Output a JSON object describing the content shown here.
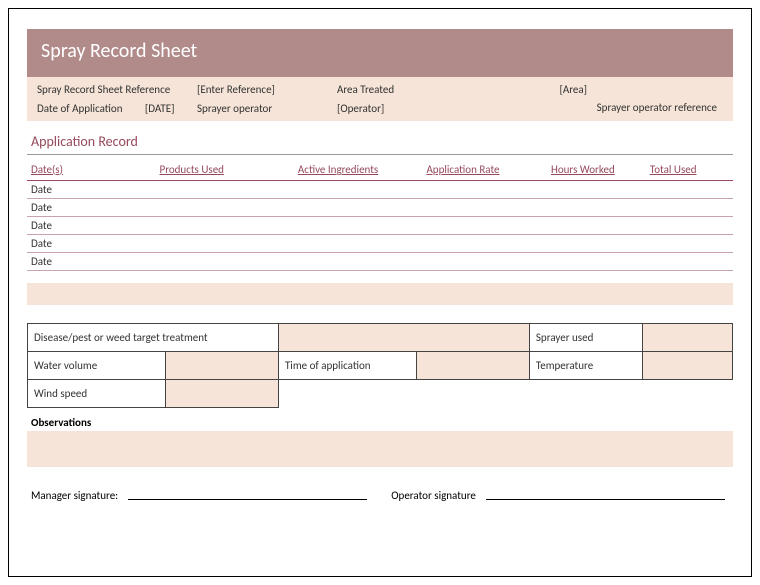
{
  "title": "Spray Record Sheet",
  "meta": {
    "ref_label": "Spray Record Sheet Reference",
    "ref_value": "[Enter Reference]",
    "area_label": "Area Treated",
    "area_value": "[Area]",
    "date_label": "Date of Application",
    "date_value": "[DATE]",
    "operator_label": "Sprayer operator",
    "operator_value": "[Operator]",
    "operator_ref_label": "Sprayer operator reference"
  },
  "section_app_record": "Application Record",
  "columns": {
    "date": "Date(s)",
    "products": "Products Used",
    "ingredients": "Active Ingredients",
    "rate": "Application Rate",
    "hours": "Hours Worked",
    "total": "Total Used"
  },
  "rows": [
    "Date",
    "Date",
    "Date",
    "Date",
    "Date"
  ],
  "details": {
    "target": "Disease/pest or weed target treatment",
    "sprayer": "Sprayer used",
    "water": "Water volume",
    "time": "Time of application",
    "temp": "Temperature",
    "wind": "Wind speed"
  },
  "observations_label": "Observations",
  "sig": {
    "manager": "Manager signature:",
    "operator": "Operator signature"
  }
}
